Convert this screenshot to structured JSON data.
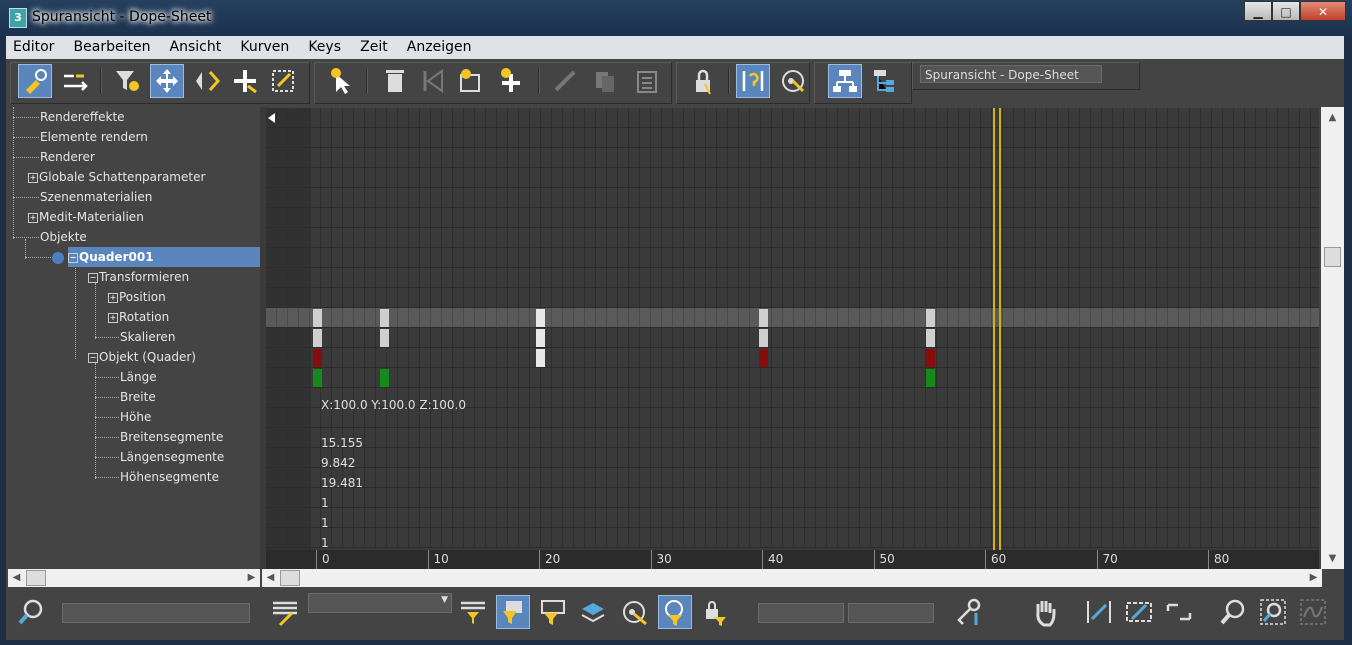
{
  "window": {
    "title": "Spuransicht - Dope-Sheet",
    "app_icon": "3"
  },
  "menubar": {
    "items": [
      "Editor",
      "Bearbeiten",
      "Ansicht",
      "Kurven",
      "Keys",
      "Zeit",
      "Anzeigen"
    ]
  },
  "toolbar": {
    "view_name": "Spuransicht - Dope-Sheet"
  },
  "tree": {
    "items": [
      {
        "label": "Rendereffekte"
      },
      {
        "label": "Elemente rendern"
      },
      {
        "label": "Renderer"
      },
      {
        "label": "Globale Schattenparameter"
      },
      {
        "label": "Szenenmaterialien"
      },
      {
        "label": "Medit-Materialien"
      },
      {
        "label": "Objekte"
      },
      {
        "label": "Quader001"
      },
      {
        "label": "Transformieren"
      },
      {
        "label": "Position"
      },
      {
        "label": "Rotation"
      },
      {
        "label": "Skalieren"
      },
      {
        "label": "Objekt (Quader)"
      },
      {
        "label": "Länge"
      },
      {
        "label": "Breite"
      },
      {
        "label": "Höhe"
      },
      {
        "label": "Breitensegmente"
      },
      {
        "label": "Längensegmente"
      },
      {
        "label": "Höhensegmente"
      }
    ]
  },
  "dopesheet": {
    "values": [
      "X:100.0 Y:100.0 Z:100.0",
      "15.155",
      "9.842",
      "19.481",
      "1",
      "1",
      "1"
    ],
    "current_frame": 61,
    "keys": [
      {
        "frame": 0,
        "rows": [
          "transformieren",
          "position",
          "rotation",
          "skalieren"
        ]
      },
      {
        "frame": 6,
        "rows": [
          "transformieren",
          "position",
          "skalieren"
        ]
      },
      {
        "frame": 20,
        "rows": [
          "transformieren",
          "position",
          "rotation"
        ]
      },
      {
        "frame": 40,
        "rows": [
          "transformieren",
          "position",
          "rotation"
        ]
      },
      {
        "frame": 55,
        "rows": [
          "transformieren",
          "position",
          "rotation",
          "skalieren"
        ]
      }
    ]
  },
  "ruler": {
    "ticks": [
      "0",
      "10",
      "20",
      "30",
      "40",
      "50",
      "60",
      "70",
      "80"
    ]
  }
}
